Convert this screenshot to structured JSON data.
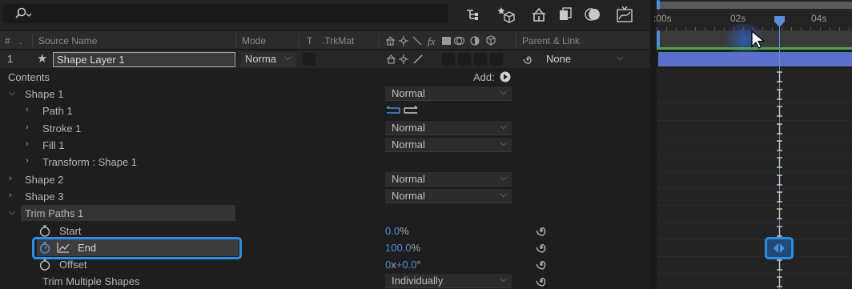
{
  "header": {
    "num": "#",
    "source_name": "Source Name",
    "mode": "Mode",
    "t": "T",
    "trkmat": ".TrkMat",
    "parent_link": "Parent & Link"
  },
  "layer": {
    "index": "1",
    "name": "Shape Layer 1",
    "mode": "Norma",
    "parent": "None"
  },
  "contents_label": "Contents",
  "add_label": "Add:",
  "rows": [
    {
      "label": "Shape 1",
      "mode": "Normal"
    },
    {
      "label": "Path 1"
    },
    {
      "label": "Stroke 1",
      "mode": "Normal"
    },
    {
      "label": "Fill 1",
      "mode": "Normal"
    },
    {
      "label": "Transform : Shape 1"
    },
    {
      "label": "Shape 2",
      "mode": "Normal"
    },
    {
      "label": "Shape 3",
      "mode": "Normal"
    },
    {
      "label": "Trim Paths 1"
    },
    {
      "label": "Start",
      "value": "0.0",
      "unit": "%"
    },
    {
      "label": "End",
      "value": "100.0",
      "unit": "%"
    },
    {
      "label": "Offset",
      "value_a": "0",
      "mid": "x",
      "value_b": "+0.0",
      "unit": "°"
    },
    {
      "label": "Trim Multiple Shapes",
      "mode": "Individually"
    }
  ],
  "timeline": {
    "ticks": [
      ":00s",
      "02s",
      "04s"
    ]
  },
  "colors": {
    "accent": "#2a8fe6",
    "value_blue": "#4a90d9",
    "layer_bar": "#5a6fc9"
  }
}
